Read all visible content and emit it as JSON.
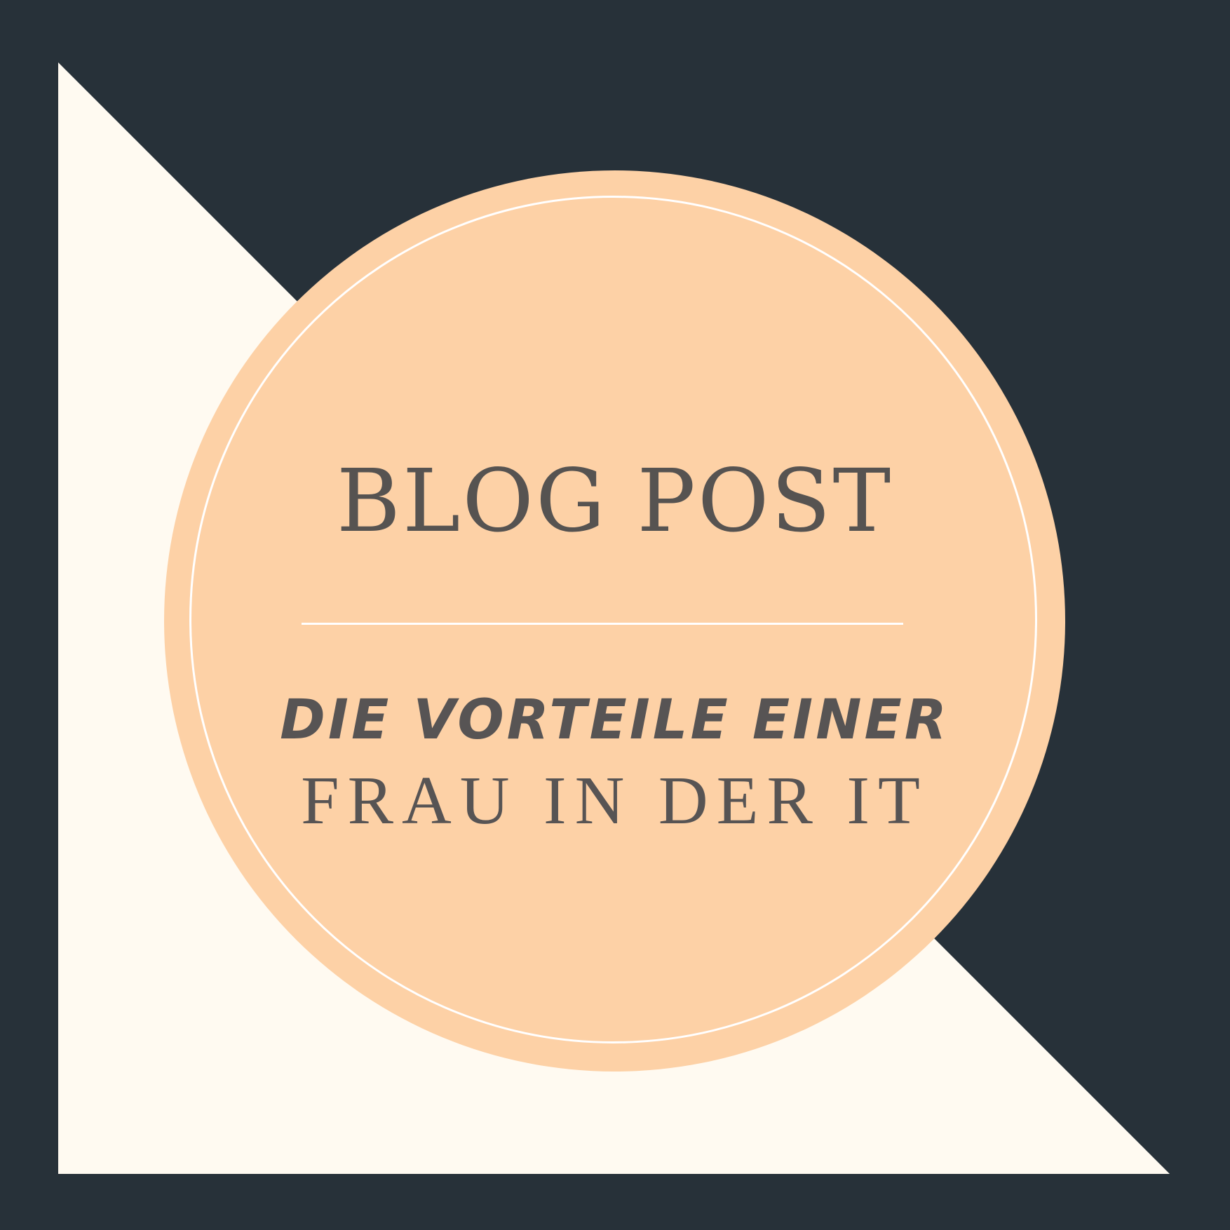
{
  "colors": {
    "backdrop": "#273139",
    "triangle": "#fffaf1",
    "badge": "#fdd1a6",
    "ring": "#ffffff",
    "text": "#575454"
  },
  "post": {
    "eyebrow": "BLOG POST",
    "title_line_1": "DIE VORTEILE EINER",
    "title_line_2": "FRAU IN DER IT"
  }
}
